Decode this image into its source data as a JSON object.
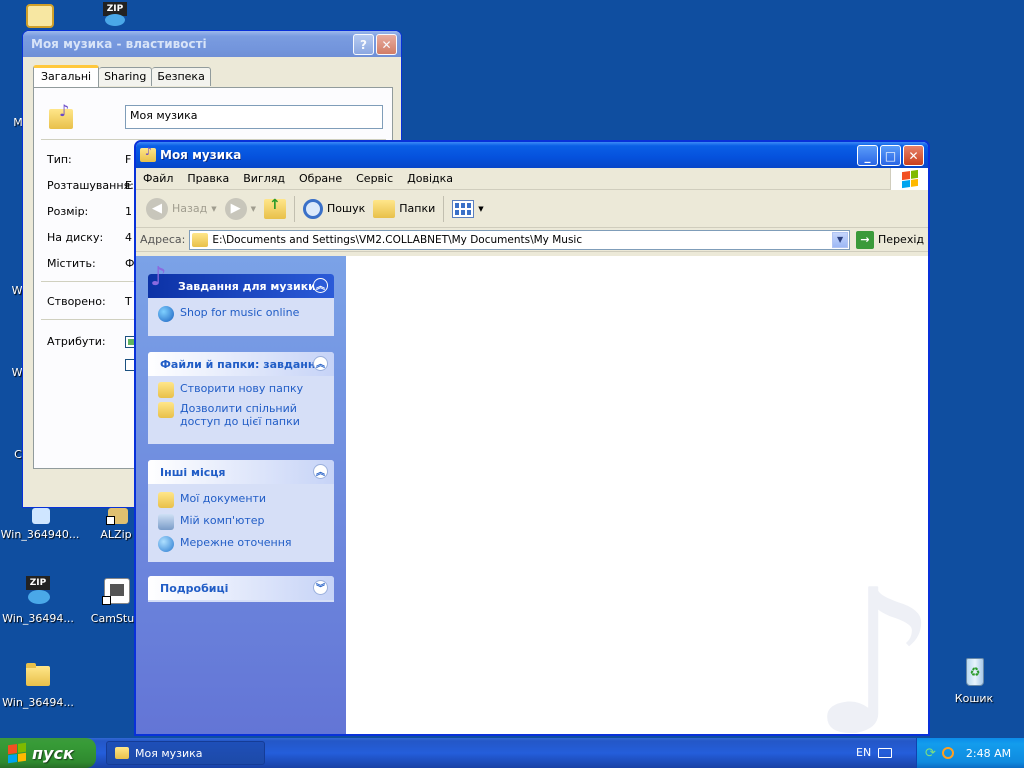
{
  "desktop": {
    "icons": [
      {
        "label": "",
        "icon": "clock-icon"
      },
      {
        "label": "",
        "icon": "zip-icon",
        "badge": "ZIP"
      },
      {
        "label": "M",
        "icon": "partial-icon"
      },
      {
        "label": "Win",
        "icon": "partial-icon"
      },
      {
        "label": "Win",
        "icon": "partial-icon"
      },
      {
        "label": "C",
        "icon": "partial-icon"
      },
      {
        "label": "Win_364940...",
        "icon": "installer-icon"
      },
      {
        "label": "ALZip",
        "icon": "alzip-shortcut-icon"
      },
      {
        "label": "Win_36494...",
        "icon": "zip-icon",
        "badge": "ZIP"
      },
      {
        "label": "CamStud",
        "icon": "camstudio-shortcut-icon"
      },
      {
        "label": "Win_36494...",
        "icon": "folder-icon"
      },
      {
        "label": "Кошик",
        "icon": "recycle-bin-icon"
      }
    ]
  },
  "properties": {
    "title": "Моя музика - властивості",
    "help_btn": "?",
    "close_btn": "✕",
    "tabs": [
      "Загальні",
      "Sharing",
      "Безпека"
    ],
    "name_value": "Моя музика",
    "labels": [
      "Тип:",
      "Розташування:",
      "Розмір:",
      "На диску:",
      "Містить:",
      "Створено:",
      "Атрибути:"
    ],
    "values_partial": [
      "F",
      "E",
      "1",
      "4",
      "Ф",
      "T"
    ]
  },
  "explorer": {
    "title": "Моя музика",
    "buttons": {
      "min": "_",
      "max": "□",
      "close": "✕"
    },
    "menu": [
      "Файл",
      "Правка",
      "Вигляд",
      "Обране",
      "Сервіс",
      "Довідка"
    ],
    "toolbar": {
      "back": "Назад",
      "search": "Пошук",
      "folders": "Папки"
    },
    "address": {
      "label": "Адреса:",
      "value": "E:\\Documents and Settings\\VM2.COLLABNET\\My Documents\\My Music",
      "go": "Перехід"
    },
    "panels": [
      {
        "title": "Завдання для музики",
        "items": [
          "Shop for music online"
        ]
      },
      {
        "title": "Файли й папки: завдання",
        "items": [
          "Створити нову папку",
          "Дозволити спільний доступ до цієї папки"
        ]
      },
      {
        "title": "Інші місця",
        "items": [
          "Мої документи",
          "Мій комп'ютер",
          "Мережне оточення"
        ]
      },
      {
        "title": "Подробиці",
        "items": []
      }
    ]
  },
  "taskbar": {
    "start_label": "пуск",
    "task_label": "Моя музика",
    "lang": "EN",
    "time": "2:48 AM"
  },
  "colors": {
    "desktop": "#0f4ea0",
    "titlebar": "#0551dc",
    "taskpanel": "#6f8fe0"
  }
}
